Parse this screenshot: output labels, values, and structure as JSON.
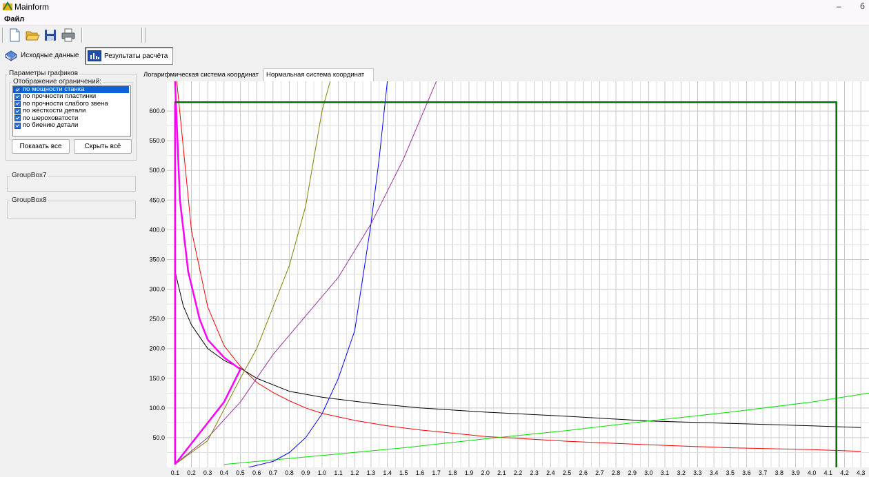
{
  "window": {
    "title": "Mainform",
    "minimize": "–",
    "restore": "б"
  },
  "menu": {
    "file": "Файл"
  },
  "toolbar": {
    "icons": [
      "new-document-icon",
      "open-folder-icon",
      "save-disk-icon",
      "print-icon"
    ]
  },
  "sections": {
    "source_label": "Исходные данные",
    "results_label": "Результаты расчёта"
  },
  "left_panel": {
    "group_title": "Параметры графиков",
    "sub_title": "Отображение ограничений:",
    "constraints": [
      {
        "label": "по мощности станка",
        "checked": true,
        "selected": true
      },
      {
        "label": "по прочности пластинки",
        "checked": true,
        "selected": false
      },
      {
        "label": "по прочности слабого звена",
        "checked": true,
        "selected": false
      },
      {
        "label": "по жёсткости детали",
        "checked": true,
        "selected": false
      },
      {
        "label": "по шероховатости",
        "checked": true,
        "selected": false
      },
      {
        "label": "по биению детали",
        "checked": true,
        "selected": false
      }
    ],
    "show_all": "Показать все",
    "hide_all": "Скрыть всё",
    "group7": "GroupBox7",
    "group8": "GroupBox8"
  },
  "tabs": {
    "log": "Логарифмическая система координат",
    "normal": "Нормальная система координат",
    "active": "normal"
  },
  "chart_data": {
    "type": "line",
    "xlim": [
      0.05,
      4.35
    ],
    "ylim": [
      0,
      650
    ],
    "grid": true,
    "x_ticks": [
      "0.1",
      "0.2",
      "0.3",
      "0.4",
      "0.5",
      "0.6",
      "0.7",
      "0.8",
      "0.9",
      "1.0",
      "1.1",
      "1.2",
      "1.3",
      "1.4",
      "1.5",
      "1.6",
      "1.7",
      "1.8",
      "1.9",
      "2.0",
      "2.1",
      "2.2",
      "2.3",
      "2.4",
      "2.5",
      "2.6",
      "2.7",
      "2.8",
      "2.9",
      "3.0",
      "3.1",
      "3.2",
      "3.3",
      "3.4",
      "3.5",
      "3.6",
      "3.7",
      "3.8",
      "3.9",
      "4.0",
      "4.1",
      "4.2",
      "4.3"
    ],
    "y_ticks": [
      "50.0",
      "100.0",
      "150.0",
      "200.0",
      "250.0",
      "300.0",
      "350.0",
      "400.0",
      "450.0",
      "500.0",
      "550.0",
      "600.0"
    ],
    "series": [
      {
        "color": "#ff0000",
        "points": [
          [
            0.1,
            680
          ],
          [
            0.2,
            400
          ],
          [
            0.3,
            270
          ],
          [
            0.4,
            205
          ],
          [
            0.5,
            170
          ],
          [
            0.6,
            143
          ],
          [
            0.7,
            126
          ],
          [
            0.8,
            112
          ],
          [
            0.9,
            100
          ],
          [
            1.0,
            91
          ],
          [
            1.2,
            79
          ],
          [
            1.4,
            70
          ],
          [
            1.6,
            63
          ],
          [
            2.0,
            52
          ],
          [
            2.5,
            44
          ],
          [
            3.0,
            38
          ],
          [
            3.5,
            33
          ],
          [
            4.0,
            30
          ],
          [
            4.3,
            27
          ]
        ]
      },
      {
        "color": "#000000",
        "points": [
          [
            0.1,
            330
          ],
          [
            0.15,
            272
          ],
          [
            0.2,
            240
          ],
          [
            0.3,
            200
          ],
          [
            0.4,
            180
          ],
          [
            0.5,
            167
          ],
          [
            0.6,
            150
          ],
          [
            0.8,
            128
          ],
          [
            1.0,
            118
          ],
          [
            1.3,
            108
          ],
          [
            1.6,
            100
          ],
          [
            2.0,
            93
          ],
          [
            2.5,
            86
          ],
          [
            3.0,
            78
          ],
          [
            3.5,
            74
          ],
          [
            4.0,
            70
          ],
          [
            4.3,
            67
          ]
        ]
      },
      {
        "color": "#00e000",
        "points": [
          [
            0.4,
            5
          ],
          [
            1.0,
            20
          ],
          [
            1.5,
            33
          ],
          [
            2.0,
            48
          ],
          [
            2.5,
            62
          ],
          [
            3.0,
            78
          ],
          [
            3.5,
            93
          ],
          [
            4.0,
            110
          ],
          [
            4.35,
            125
          ]
        ]
      },
      {
        "color": "#0000ff",
        "points": [
          [
            0.55,
            0
          ],
          [
            0.7,
            10
          ],
          [
            0.8,
            25
          ],
          [
            0.9,
            50
          ],
          [
            1.0,
            90
          ],
          [
            1.1,
            150
          ],
          [
            1.2,
            230
          ],
          [
            1.3,
            410
          ],
          [
            1.35,
            520
          ],
          [
            1.4,
            650
          ]
        ]
      },
      {
        "color": "#993399",
        "points": [
          [
            0.1,
            5
          ],
          [
            0.3,
            50
          ],
          [
            0.5,
            110
          ],
          [
            0.7,
            190
          ],
          [
            0.9,
            255
          ],
          [
            1.1,
            320
          ],
          [
            1.3,
            410
          ],
          [
            1.5,
            520
          ],
          [
            1.7,
            650
          ]
        ]
      },
      {
        "color": "#808000",
        "points": [
          [
            0.1,
            5
          ],
          [
            0.3,
            45
          ],
          [
            0.5,
            150
          ],
          [
            0.6,
            200
          ],
          [
            0.7,
            270
          ],
          [
            0.8,
            340
          ],
          [
            0.9,
            440
          ],
          [
            1.0,
            600
          ],
          [
            1.05,
            650
          ]
        ]
      },
      {
        "color": "#ff00ff",
        "bold": true,
        "points": [
          [
            0.1,
            650
          ],
          [
            0.13,
            450
          ],
          [
            0.18,
            330
          ],
          [
            0.25,
            250
          ],
          [
            0.3,
            215
          ],
          [
            0.4,
            185
          ],
          [
            0.5,
            165
          ],
          [
            0.4,
            110
          ],
          [
            0.3,
            75
          ],
          [
            0.2,
            40
          ],
          [
            0.1,
            5
          ]
        ]
      },
      {
        "color": "#ff00ff",
        "bold": true,
        "points": [
          [
            0.1,
            5
          ],
          [
            0.1,
            615
          ],
          [
            0.15,
            615
          ]
        ]
      },
      {
        "color": "#007000",
        "bold": true,
        "points": [
          [
            0.1,
            615
          ],
          [
            4.15,
            615
          ],
          [
            4.15,
            0
          ]
        ]
      }
    ]
  }
}
